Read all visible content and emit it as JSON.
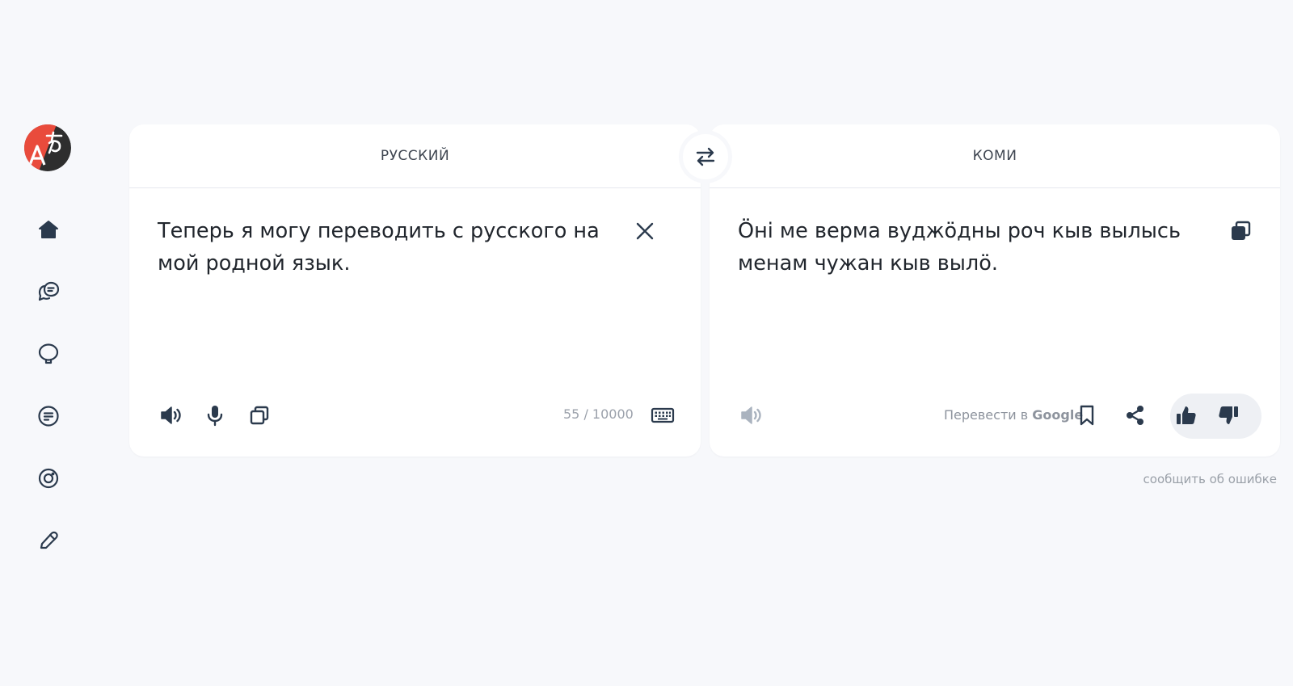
{
  "source": {
    "language": "РУССКИЙ",
    "text": "Теперь я могу переводить с русского на мой родной язык.",
    "counter": "55 / 10000"
  },
  "target": {
    "language": "КОМИ",
    "text": "Öні ме верма вуджӧдны роч кыв вылысь менам чужан кыв вылӧ.",
    "google_prefix": "Перевести в ",
    "google_brand": "Google"
  },
  "report_error": "сообщить об ошибке",
  "colors": {
    "background": "#f7f8fb",
    "panel": "#ffffff",
    "icon": "#2b3a4d",
    "logo_red": "#e94b3c",
    "logo_dark": "#2e2e2e"
  },
  "icons": {
    "sidebar": [
      "home-icon",
      "chat-bubbles-icon",
      "speech-bubble-icon",
      "document-icon",
      "camera-icon",
      "pencil-icon"
    ],
    "source_toolbar": [
      "speaker-icon",
      "microphone-icon",
      "copy-icon",
      "keyboard-icon",
      "clear-icon"
    ],
    "target_toolbar": [
      "speaker-icon",
      "bookmark-icon",
      "share-icon",
      "thumbs-up-icon",
      "thumbs-down-icon",
      "copy-icon"
    ],
    "swap": "swap-arrows-icon"
  }
}
